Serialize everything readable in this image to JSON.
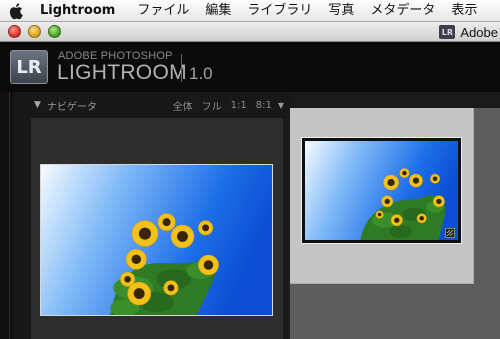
{
  "menubar": {
    "app_name": "Lightroom",
    "items": [
      "ファイル",
      "編集",
      "ライブラリ",
      "写真",
      "メタデータ",
      "表示"
    ]
  },
  "window": {
    "title": "Adobe",
    "icon_text": "LR"
  },
  "identity_plate": {
    "logo_text": "LR",
    "brand_top": "ADOBE PHOTOSHOP",
    "brand_main": "LIGHTROOM",
    "version": "1.0"
  },
  "navigator": {
    "title": "ナビゲータ",
    "zoom_options": [
      "全体",
      "フル",
      "1:1",
      "8:1"
    ]
  },
  "icons": {
    "apple": "apple-icon",
    "disclosure": "disclosure-triangle-icon",
    "dropdown": "dropdown-arrow-icon",
    "badge": "edit-badge-icon"
  },
  "colors": {
    "sky": "#1f6ee6",
    "petal": "#f2c21a",
    "leaf": "#2f7a24"
  }
}
